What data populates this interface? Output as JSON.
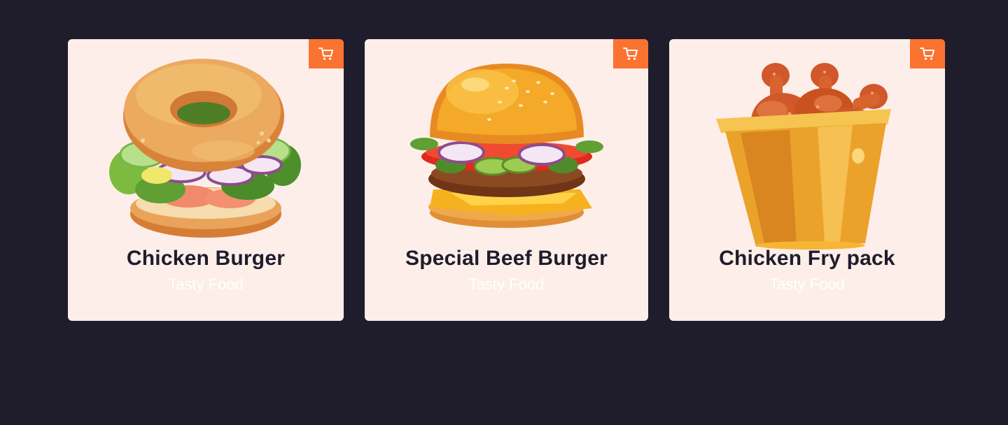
{
  "colors": {
    "background": "#1f1c2c",
    "card": "#fdeee9",
    "accent": "#fb7330"
  },
  "cards": [
    {
      "title": "Chicken Burger",
      "subtitle": "Tasty Food",
      "image": "bagel-burger-illustration",
      "cart_icon": "cart-icon"
    },
    {
      "title": "Special Beef Burger",
      "subtitle": "Tasty Food",
      "image": "beef-burger-illustration",
      "cart_icon": "cart-icon"
    },
    {
      "title": "Chicken Fry pack",
      "subtitle": "Tasty Food",
      "image": "fried-chicken-bucket-illustration",
      "cart_icon": "cart-icon"
    }
  ]
}
